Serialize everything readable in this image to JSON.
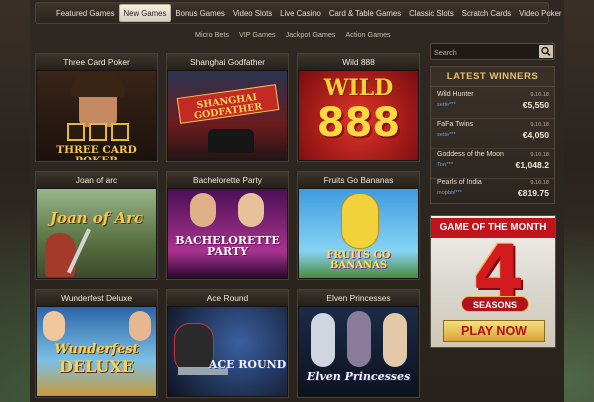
{
  "nav": {
    "items": [
      {
        "label": "Featured Games"
      },
      {
        "label": "New Games"
      },
      {
        "label": "Bonus Games"
      },
      {
        "label": "Video Slots"
      },
      {
        "label": "Live Casino"
      },
      {
        "label": "Card & Table Games"
      },
      {
        "label": "Classic Slots"
      },
      {
        "label": "Scratch Cards"
      },
      {
        "label": "Video Poker"
      }
    ],
    "active_index": 1
  },
  "subnav": {
    "items": [
      {
        "label": "Micro Bets"
      },
      {
        "label": "VIP Games"
      },
      {
        "label": "Jackpot Games"
      },
      {
        "label": "Action Games"
      }
    ]
  },
  "games": [
    {
      "title": "Three Card Poker",
      "art_text": "THREE CARD POKER",
      "colors": [
        "#1e1712",
        "#4a2a1c"
      ]
    },
    {
      "title": "Shanghai Godfather",
      "art_text": "SHANGHAI GODFATHER",
      "colors": [
        "#2a1216",
        "#8a2a1e"
      ]
    },
    {
      "title": "Wild 888",
      "art_text_top": "WILD",
      "art_text": "888",
      "colors": [
        "#7a0d10",
        "#d52a1f"
      ]
    },
    {
      "title": "Joan of arc",
      "art_text": "Joan of Arc",
      "colors": [
        "#5c7a4a",
        "#c5b071"
      ]
    },
    {
      "title": "Bachelorette Party",
      "art_text": "BACHELORETTE PARTY",
      "colors": [
        "#5b1466",
        "#c63c8a"
      ]
    },
    {
      "title": "Fruits Go Bananas",
      "art_text": "FRUITS GO BANANAS",
      "colors": [
        "#2f8ad0",
        "#7fcff0"
      ]
    },
    {
      "title": "Wunderfest Deluxe",
      "art_text_top": "Wunderfest",
      "art_text": "DELUXE",
      "colors": [
        "#2b5fa0",
        "#7cc2e7"
      ]
    },
    {
      "title": "Ace Round",
      "art_text": "ACE ROUND",
      "colors": [
        "#121824",
        "#2b3d5c"
      ]
    },
    {
      "title": "Elven Princesses",
      "art_text": "Elven Princesses",
      "colors": [
        "#0f1b2e",
        "#3b4d6b"
      ]
    }
  ],
  "search": {
    "placeholder": "Search"
  },
  "winners": {
    "title": "LATEST WINNERS",
    "items": [
      {
        "game": "Wild Hunter",
        "user": "sette***",
        "date": "9.10.18",
        "amount": "€5,550"
      },
      {
        "game": "FaFa Twins",
        "user": "sette***",
        "date": "9.10.18",
        "amount": "€4,050"
      },
      {
        "game": "Goddess of the Moon",
        "user": "Torr***",
        "date": "9.10.18",
        "amount": "€1,048.2"
      },
      {
        "game": "Pearls of India",
        "user": "mopbbl***",
        "date": "9.10.18",
        "amount": "€819.75"
      }
    ]
  },
  "gotm": {
    "title": "GAME OF THE MONTH",
    "big": "4",
    "word": "SEASONS",
    "button": "PLAY NOW"
  },
  "colors": {
    "accent_gold": "#e7c06a",
    "active_tab": "#f4efe4",
    "play_red": "#c0141a"
  }
}
